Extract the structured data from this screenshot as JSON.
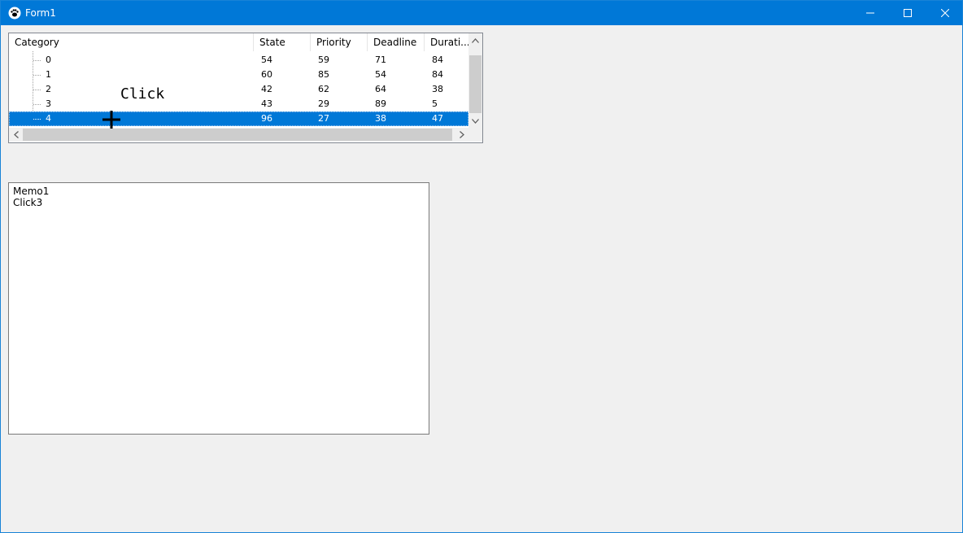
{
  "window": {
    "title": "Form1"
  },
  "treelist": {
    "columns": [
      "Category",
      "State",
      "Priority",
      "Deadline",
      "Durati..."
    ],
    "rows": [
      {
        "category": "0",
        "state": "54",
        "priority": "59",
        "deadline": "71",
        "duration": "84",
        "selected": false
      },
      {
        "category": "1",
        "state": "60",
        "priority": "85",
        "deadline": "54",
        "duration": "84",
        "selected": false
      },
      {
        "category": "2",
        "state": "42",
        "priority": "62",
        "deadline": "64",
        "duration": "38",
        "selected": false
      },
      {
        "category": "3",
        "state": "43",
        "priority": "29",
        "deadline": "89",
        "duration": "5",
        "selected": false
      },
      {
        "category": "4",
        "state": "96",
        "priority": "27",
        "deadline": "38",
        "duration": "47",
        "selected": true
      }
    ],
    "selection_color": "#0078d7"
  },
  "overlay": {
    "click_label": "Click"
  },
  "memo": {
    "lines": [
      "Memo1",
      "Click3"
    ]
  },
  "colors": {
    "titlebar": "#0078d7",
    "background": "#f0f0f0"
  }
}
